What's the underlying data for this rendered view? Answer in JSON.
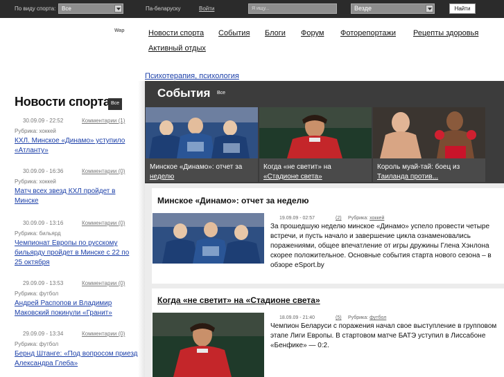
{
  "topbar": {
    "sport_label": "По виду спорта:",
    "sport_value": "Все",
    "lang_link": "Па-беларуску",
    "login_link": "Войти",
    "search_placeholder": "Я ищу...",
    "scope_value": "Везде",
    "find_button": "Найти"
  },
  "header": {
    "wap": "Wap"
  },
  "nav": {
    "items": [
      "Новости спорта",
      "События",
      "Блоги",
      "Форум",
      "Фоторепортажи",
      "Рецепты здоровья",
      "Активный отдых"
    ],
    "sub": "Психотерапия, психология"
  },
  "left": {
    "title": "Новости спорта",
    "all_badge": "Все",
    "rubric_label": "Рубрика:",
    "news": [
      {
        "date": "30.09.09 - 22:52",
        "comments": "Комментарии (1)",
        "rubric": "хоккей",
        "headline": "КХЛ. Минское «Динамо» уступило «Атланту»"
      },
      {
        "date": "30.09.09 - 16:36",
        "comments": "Комментарии (0)",
        "rubric": "хоккей",
        "headline": "Матч всех звезд КХЛ пройдет в Минске"
      },
      {
        "date": "30.09.09 - 13:16",
        "comments": "Комментарии (0)",
        "rubric": "бильярд",
        "headline": "Чемпионат Европы по русскому бильярду пройдет в Минске с 22 по 25 октября"
      },
      {
        "date": "29.09.09 - 13:53",
        "comments": "Комментарии (0)",
        "rubric": "футбол",
        "headline": "Андрей Распопов и Владимир Маковский покинули «Гранит»"
      },
      {
        "date": "29.09.09 - 13:34",
        "comments": "Комментарии (0)",
        "rubric": "футбол",
        "headline": "Бернд Штанге: «Под вопросом приезд Александра Глеба»"
      }
    ]
  },
  "events": {
    "title": "События",
    "all_label": "Все",
    "cards": [
      {
        "line1": "Минское «Динамо»: отчет за",
        "line2": "неделю"
      },
      {
        "line1": "Когда «не светит» на",
        "line2": "«Стадионе света»"
      },
      {
        "line1": "Король муай-тай: боец из",
        "line2": "Таиланда против..."
      }
    ]
  },
  "articles": [
    {
      "title": "Минское «Динамо»: отчет за неделю",
      "date": "19.09.09 - 02:57",
      "comments": "(2)",
      "rubric_label": "Рубрика:",
      "rubric": "хоккей",
      "text": "За прошедшую неделю минское «Динамо» успело провести четыре встречи, и пусть начало и завершение цикла ознаменовались поражениями, общее впечатление от игры дружины Глена Хэнлона скорее положительное. Основные события старта нового сезона – в обзоре eSport.by"
    },
    {
      "title": "Когда «не светит» на «Стадионе света»",
      "date": "18.09.09 - 21:40",
      "comments": "(5)",
      "rubric_label": "Рубрика:",
      "rubric": "футбол",
      "text": "Чемпион Беларуси с поражения начал свое выступление в групповом этапе Лиги Европы. В стартовом матче БАТЭ уступил в Лиссабоне «Бенфике» — 0:2."
    }
  ],
  "colors": {
    "topbar": "#2b2b2b",
    "events_bg": "#3c3c3c",
    "link": "#1a3ea8"
  }
}
